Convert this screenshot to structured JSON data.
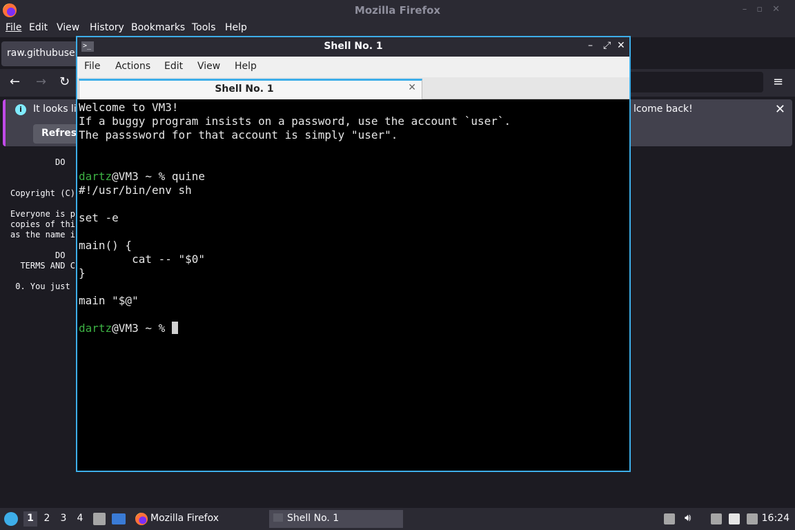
{
  "firefox": {
    "window_title": "Mozilla Firefox",
    "menu": [
      "File",
      "Edit",
      "View",
      "History",
      "Bookmarks",
      "Tools",
      "Help"
    ],
    "tab_label": "raw.githubuser",
    "notification": {
      "text_start": "It looks lik",
      "text_end": "lcome back!",
      "refresh_label": "Refresh"
    },
    "content_lines": [
      "         DO",
      "Copyright (C)",
      "Everyone is p",
      "copies of thi",
      "as the name i",
      "         DO",
      "  TERMS AND C",
      " 0. You just"
    ]
  },
  "terminal": {
    "window_title": "Shell No. 1",
    "menu": [
      "File",
      "Actions",
      "Edit",
      "View",
      "Help"
    ],
    "tab_label": "Shell No. 1",
    "lines": [
      {
        "text": "Welcome to VM3!"
      },
      {
        "text": "If a buggy program insists on a password, use the account `user`."
      },
      {
        "text": "The passsword for that account is simply \"user\"."
      },
      {
        "text": ""
      },
      {
        "text": ""
      },
      {
        "user": "dartz",
        "rest": "@VM3 ~ % quine"
      },
      {
        "text": "#!/usr/bin/env sh"
      },
      {
        "text": ""
      },
      {
        "text": "set -e"
      },
      {
        "text": ""
      },
      {
        "text": "main() {"
      },
      {
        "text": "        cat -- \"$0\""
      },
      {
        "text": "}"
      },
      {
        "text": ""
      },
      {
        "text": "main \"$@\""
      },
      {
        "text": ""
      },
      {
        "user": "dartz",
        "rest": "@VM3 ~ % ",
        "cursor": true
      }
    ]
  },
  "taskbar": {
    "workspaces": [
      "1",
      "2",
      "3",
      "4"
    ],
    "tasks": [
      "Mozilla Firefox",
      "Shell No. 1"
    ],
    "clock": "16:24"
  }
}
